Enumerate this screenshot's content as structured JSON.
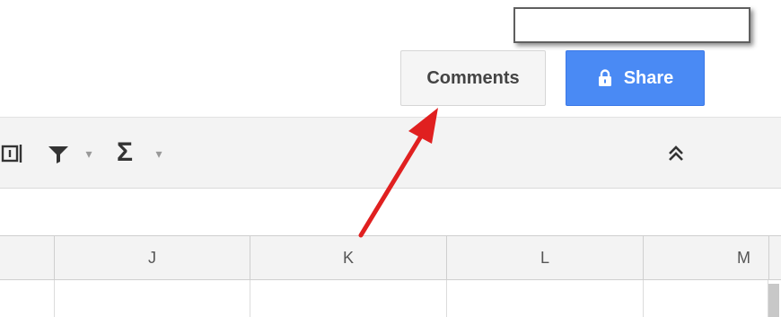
{
  "header": {
    "comments_label": "Comments",
    "share_label": "Share"
  },
  "toolbar": {
    "filter_caret": "▾",
    "sum_symbol": "Σ",
    "sum_caret": "▾",
    "collapse_symbol": "︽"
  },
  "grid": {
    "columns": [
      "J",
      "K",
      "L",
      "M"
    ]
  },
  "colors": {
    "share_blue": "#4a8af4",
    "annotation_arrow": "#e02020"
  }
}
